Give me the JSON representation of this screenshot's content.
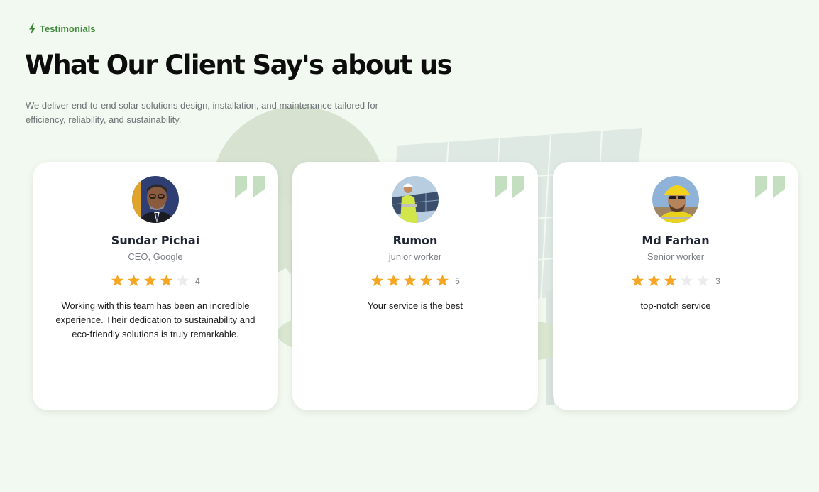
{
  "section_label": "Testimonials",
  "title": "What Our Client Say's about us",
  "description": "We deliver end-to-end solar solutions design, installation, and maintenance tailored for efficiency, reliability, and sustainability.",
  "colors": {
    "accent": "#3f8a3a",
    "star_filled": "#f5a623",
    "star_empty": "#ececec",
    "quote_mark": "#c3dfc0"
  },
  "icons": {
    "section_label": "lightning-bolt-icon",
    "quote": "quote-icon",
    "star": "star-icon"
  },
  "testimonials": [
    {
      "name": "Sundar Pichai",
      "role": "CEO, Google",
      "rating": 4,
      "max_rating": 5,
      "rating_label": "4",
      "review": "Working with this team has been an incredible experience. Their dedication to sustainability and eco-friendly solutions is truly remarkable."
    },
    {
      "name": "Rumon",
      "role": "junior worker",
      "rating": 5,
      "max_rating": 5,
      "rating_label": "5",
      "review": "Your service is the best"
    },
    {
      "name": "Md Farhan",
      "role": "Senior worker",
      "rating": 3,
      "max_rating": 5,
      "rating_label": "3",
      "review": "top-notch service"
    }
  ]
}
